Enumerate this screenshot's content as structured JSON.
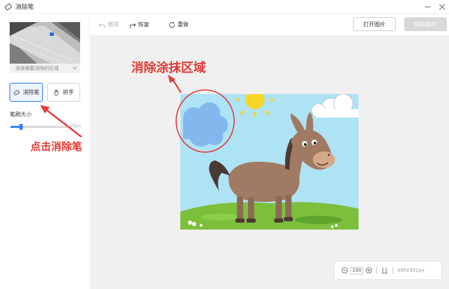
{
  "window": {
    "title": "消除笔"
  },
  "left_panel": {
    "thumbnail_caption": "涂抹需要消除的区域",
    "tools": {
      "eraser_label": "消除笔",
      "grab_label": "抓手"
    },
    "brush": {
      "label": "笔刷大小",
      "value_text": "15px",
      "level_fraction": 0.18
    }
  },
  "toolbar": {
    "undo_label": "撤销",
    "redo_label": "恢复",
    "reset_label": "重做",
    "open_label": "打开图片",
    "save_label": "保存图片"
  },
  "zoom": {
    "value": "100",
    "dimensions": "395x301px"
  },
  "annotations": {
    "erase_area": "消除涂抹区域",
    "click_eraser": "点击消除笔"
  },
  "colors": {
    "accent": "#3b82f6",
    "annotation": "#e53935",
    "canvas_bg": "#f0f0f0"
  }
}
